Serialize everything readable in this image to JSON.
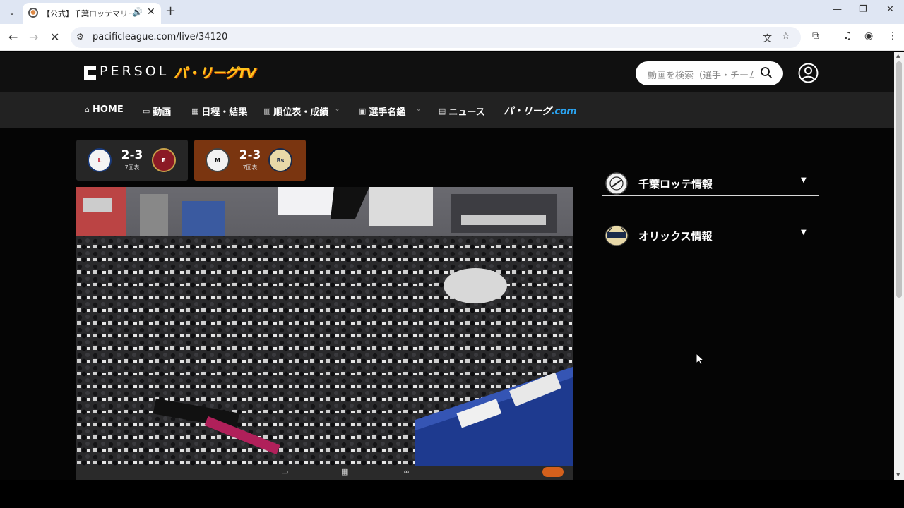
{
  "browser": {
    "tab_title": "【公式】千葉ロッテマリーンズ",
    "audio_icon": "speaker-icon",
    "url": "pacificleague.com/live/34120"
  },
  "site": {
    "brand": "PERSOL",
    "tv_logo": "パ・リーグTV",
    "search_placeholder": "動画を検索（選手・チーム名）",
    "nav": [
      {
        "label": "HOME",
        "icon": "home-icon"
      },
      {
        "label": "動画",
        "icon": "video-icon"
      },
      {
        "label": "日程・結果",
        "icon": "calendar-icon"
      },
      {
        "label": "順位表・成績",
        "icon": "bar-chart-icon"
      },
      {
        "label": "選手名鑑",
        "icon": "player-card-icon"
      },
      {
        "label": "ニュース",
        "icon": "newspaper-icon"
      }
    ],
    "pl_com_main": "パ・リーグ",
    "pl_com_suffix": ".com"
  },
  "games": [
    {
      "score": "2-3",
      "inning": "7回表",
      "home": "L",
      "away": "E",
      "selected": false
    },
    {
      "score": "2-3",
      "inning": "7回表",
      "home": "M",
      "away": "Bs",
      "selected": true
    }
  ],
  "panels": [
    {
      "title": "千葉ロッテ情報"
    },
    {
      "title": "オリックス情報"
    }
  ],
  "colors": {
    "tv_logo": "#ffc21c",
    "selected_game": "#7a3510",
    "nav_bg": "#222222"
  }
}
